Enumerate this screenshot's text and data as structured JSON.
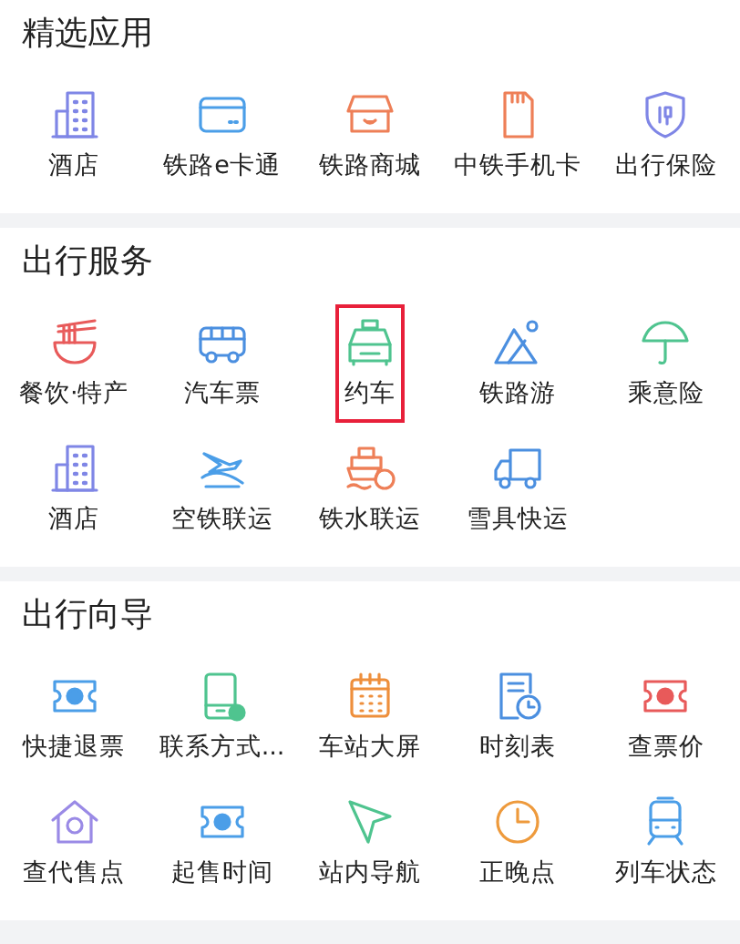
{
  "sections": [
    {
      "title": "精选应用",
      "items": [
        {
          "label": "酒店",
          "highlighted": false
        },
        {
          "label": "铁路e卡通",
          "highlighted": false
        },
        {
          "label": "铁路商城",
          "highlighted": false
        },
        {
          "label": "中铁手机卡",
          "highlighted": false
        },
        {
          "label": "出行保险",
          "highlighted": false
        }
      ]
    },
    {
      "title": "出行服务",
      "items": [
        {
          "label": "餐饮·特产",
          "highlighted": false
        },
        {
          "label": "汽车票",
          "highlighted": false
        },
        {
          "label": "约车",
          "highlighted": true
        },
        {
          "label": "铁路游",
          "highlighted": false
        },
        {
          "label": "乘意险",
          "highlighted": false
        },
        {
          "label": "酒店",
          "highlighted": false
        },
        {
          "label": "空铁联运",
          "highlighted": false
        },
        {
          "label": "铁水联运",
          "highlighted": false
        },
        {
          "label": "雪具快运",
          "highlighted": false
        }
      ]
    },
    {
      "title": "出行向导",
      "items": [
        {
          "label": "快捷退票",
          "highlighted": false
        },
        {
          "label": "联系方式...",
          "highlighted": false
        },
        {
          "label": "车站大屏",
          "highlighted": false
        },
        {
          "label": "时刻表",
          "highlighted": false
        },
        {
          "label": "查票价",
          "highlighted": false
        },
        {
          "label": "查代售点",
          "highlighted": false
        },
        {
          "label": "起售时间",
          "highlighted": false
        },
        {
          "label": "站内导航",
          "highlighted": false
        },
        {
          "label": "正晚点",
          "highlighted": false
        },
        {
          "label": "列车状态",
          "highlighted": false
        }
      ]
    }
  ]
}
